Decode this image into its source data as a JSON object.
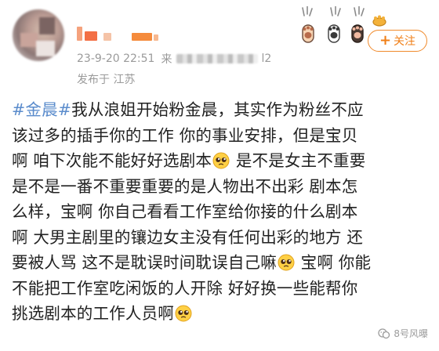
{
  "header": {
    "datetime": "23-9-20 22:51",
    "source_prefix": "来",
    "source_suffix": "l2",
    "ip_location": "发布于 江苏",
    "follow_label": "关注",
    "follow_icon": "plus-icon",
    "accent_color": "#f08a2c"
  },
  "post": {
    "lines": [
      {
        "topic": "#金晨#",
        "text": "我从浪姐开始粉金晨，其实作为粉丝不应"
      },
      {
        "text": "该过多的插手你的工作 你的事业安排，但是宝贝"
      },
      {
        "text_a": "啊 咱下次能不能好好选剧本",
        "emoji": "pleading-face-emoji",
        "text_b": " 是不是女主不重要"
      },
      {
        "text": "是不是一番不重要重要的是人物出不出彩 剧本怎"
      },
      {
        "text": "么样，宝啊 你自己看看工作室给你接的什么剧本"
      },
      {
        "text": "啊 大男主剧里的镶边女主没有任何出彩的地方 还"
      },
      {
        "text_a": "要被人骂 这不是耽误时间耽误自己嘛",
        "emoji": "pleading-face-emoji",
        "text_b": " 宝啊 你能"
      },
      {
        "text": "不能把工作室吃闲饭的人开除 好好换一些能帮你"
      },
      {
        "text_a": "挑选剧本的工作人员啊",
        "emoji": "pleading-face-emoji"
      }
    ],
    "topic_color": "#5b8ccc"
  },
  "watermark": {
    "text": "8号风曝",
    "icon": "wechat-official-account-icon"
  }
}
